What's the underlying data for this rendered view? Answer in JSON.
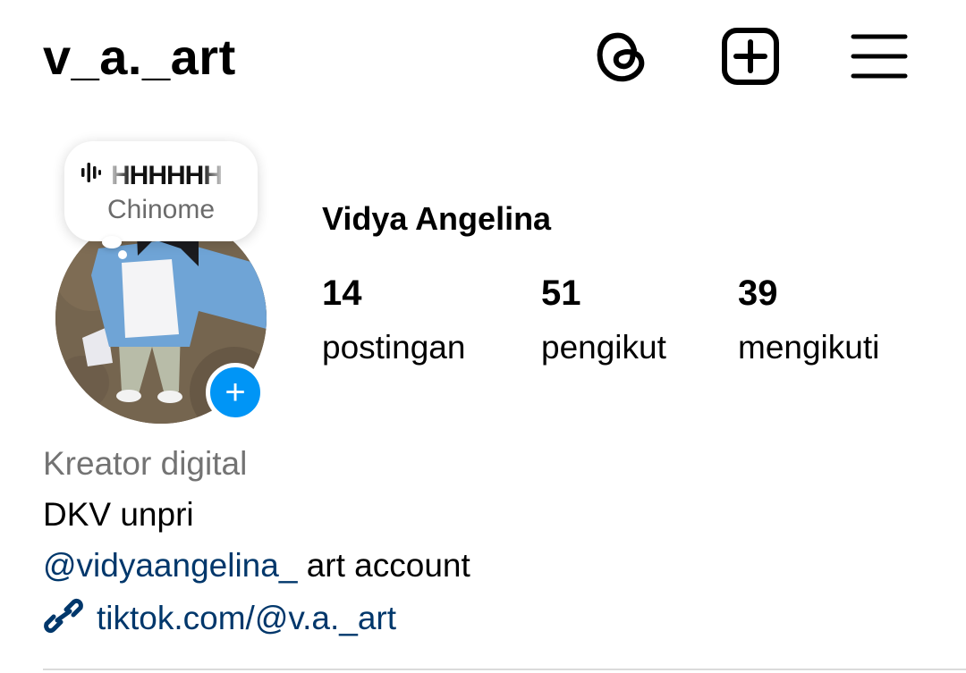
{
  "header": {
    "username": "v_a._art",
    "icons": [
      "threads-icon",
      "plus-square-icon",
      "menu-icon"
    ]
  },
  "note": {
    "text": "HHHHHH",
    "subtitle": "Chinome",
    "icon": "audio-wave-icon"
  },
  "profile": {
    "full_name": "Vidya Angelina",
    "stats": [
      {
        "value": "14",
        "label": "postingan"
      },
      {
        "value": "51",
        "label": "pengikut"
      },
      {
        "value": "39",
        "label": "mengikuti"
      }
    ]
  },
  "bio": {
    "category": "Kreator digital",
    "line1": "DKV unpri",
    "mention": "@vidyaangelina_",
    "line2_rest": " art account",
    "link": "tiktok.com/@v.a._art"
  },
  "colors": {
    "accent_blue": "#0095f6",
    "link_blue": "#00376b",
    "secondary_text": "#737373"
  }
}
